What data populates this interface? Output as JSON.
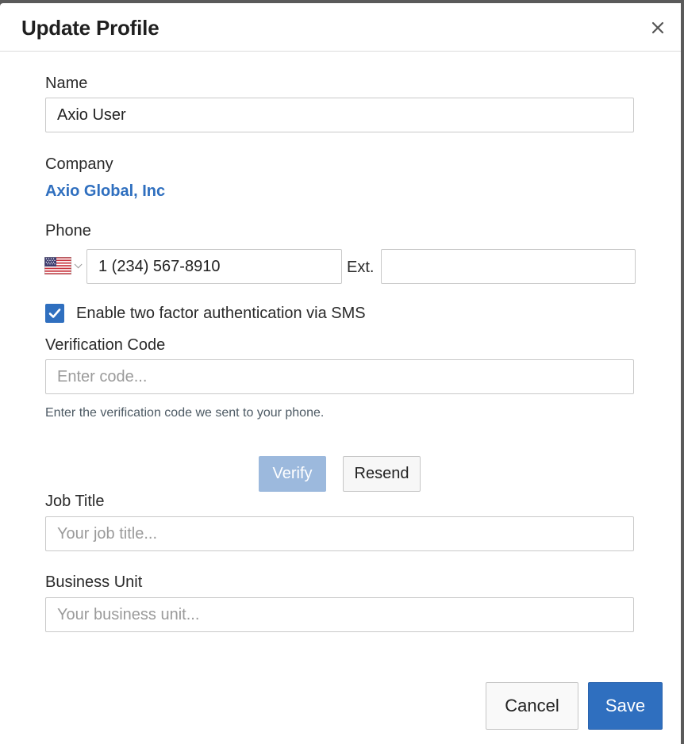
{
  "dialog": {
    "title": "Update Profile",
    "close_icon": "close-icon"
  },
  "name": {
    "label": "Name",
    "value": "Axio User"
  },
  "company": {
    "label": "Company",
    "value": "Axio Global, Inc"
  },
  "phone": {
    "label": "Phone",
    "country_flag_icon": "us-flag-icon",
    "value": "1 (234) 567-8910",
    "ext_label": "Ext.",
    "ext_value": ""
  },
  "two_factor": {
    "checked": true,
    "label": "Enable two factor authentication via SMS"
  },
  "verification": {
    "label": "Verification Code",
    "placeholder": "Enter code...",
    "help_text": "Enter the verification code we sent to your phone.",
    "verify_label": "Verify",
    "resend_label": "Resend"
  },
  "job_title": {
    "label": "Job Title",
    "placeholder": "Your job title..."
  },
  "business_unit": {
    "label": "Business Unit",
    "placeholder": "Your business unit..."
  },
  "footer": {
    "cancel_label": "Cancel",
    "save_label": "Save"
  },
  "colors": {
    "accent": "#2f6fbf",
    "accent_disabled": "#9cb9dd"
  }
}
